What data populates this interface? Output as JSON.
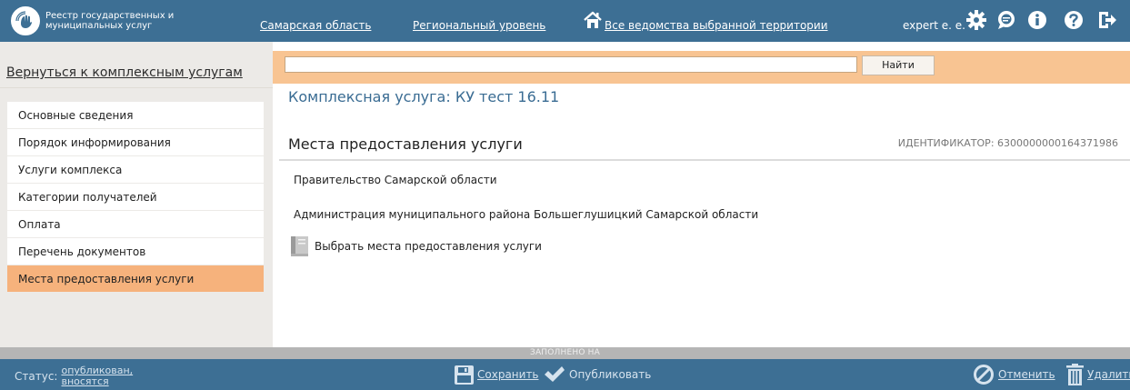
{
  "topbar": {
    "logo_text": "Реестр государственных и муниципальных услуг",
    "region": "Самарская область",
    "level": "Региональный уровень",
    "departments": "Все ведомства выбранной территории",
    "user": "expert e. e."
  },
  "sidebar": {
    "back_link": "Вернуться к комплексным услугам",
    "items": [
      {
        "label": "Основные сведения"
      },
      {
        "label": "Порядок информирования"
      },
      {
        "label": "Услуги комплекса"
      },
      {
        "label": "Категории получателей"
      },
      {
        "label": "Оплата"
      },
      {
        "label": "Перечень документов"
      },
      {
        "label": "Места предоставления услуги"
      }
    ],
    "active_index": 6
  },
  "search": {
    "value": "",
    "button_label": "Найти"
  },
  "main": {
    "complex_title": "Комплексная услуга: КУ тест 16.11",
    "section_title": "Места предоставления услуги",
    "identifier": "ИДЕНТИФИКАТОР: 6300000000164371986",
    "places": [
      "Правительство Самарской области",
      "Администрация муниципального района Большеглушицкий Самарской области"
    ],
    "choose_label": "Выбрать места предоставления услуги"
  },
  "footer": {
    "filled_label": "ЗАПОЛНЕНО НА",
    "status_label": "Статус:",
    "status_value": "опубликован, вносятся изменения",
    "save_label": "Сохранить",
    "publish_label": "Опубликовать",
    "cancel_label": "Отменить",
    "delete_label": "Удалить"
  },
  "icons": {
    "logo": "hand-logo-icon",
    "home": "home-icon",
    "settings": "gear-icon",
    "messages": "chat-icon",
    "info": "info-icon",
    "help": "help-icon",
    "logout": "logout-icon",
    "choose": "book-icon",
    "save": "floppy-icon",
    "publish": "checkmark-icon",
    "cancel": "cancel-icon",
    "delete": "trash-icon"
  },
  "colors": {
    "topbar": "#3d6f94",
    "accent": "#f6b27c",
    "search_strip": "#f8c492",
    "title_blue": "#3a6c93"
  }
}
